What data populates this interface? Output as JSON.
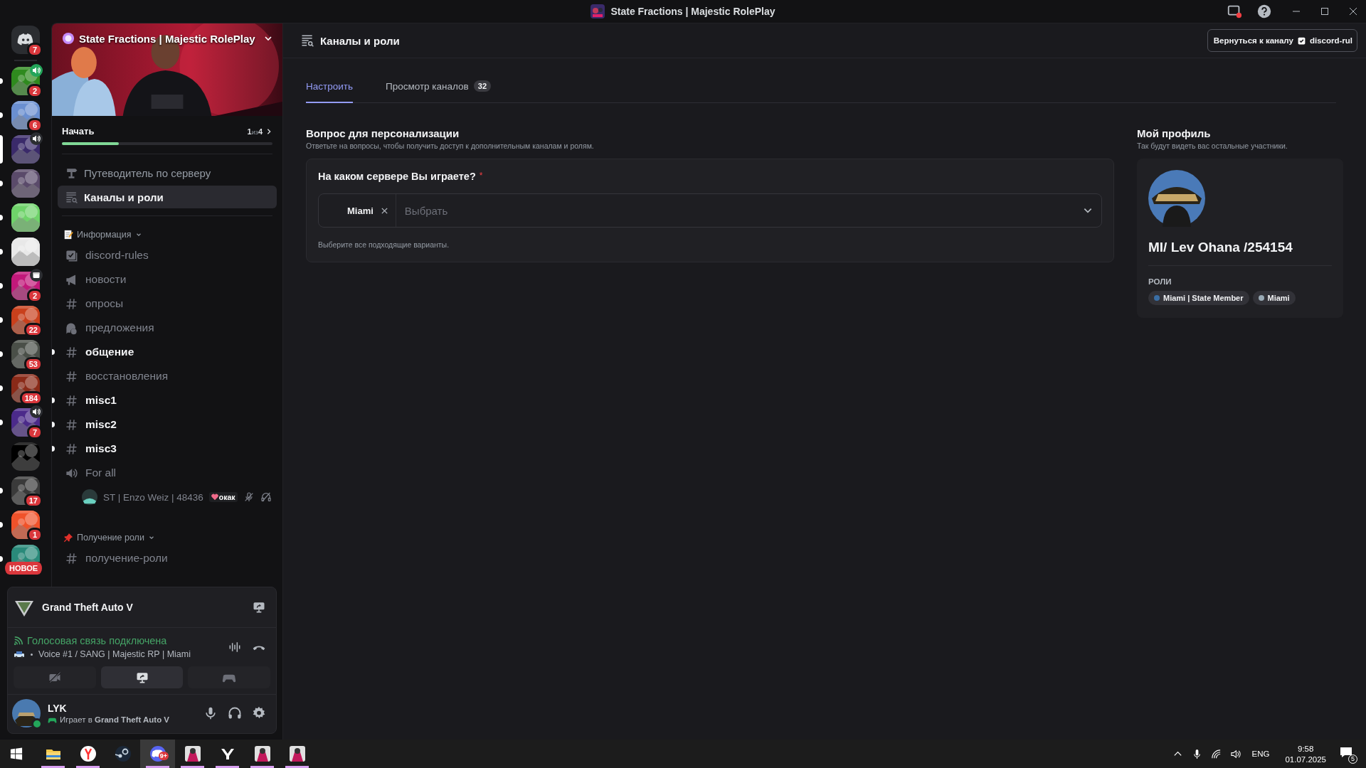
{
  "title_bar": {
    "title": "State Fractions | Majestic RolePlay"
  },
  "servers": [
    {
      "kind": "home",
      "badge": "7",
      "voice": false,
      "event": false,
      "unread": false,
      "selected": false,
      "color": "#2b2d31"
    },
    {
      "kind": "server",
      "badge": "2",
      "voice": true,
      "event": false,
      "unread": true,
      "selected": false,
      "color": "#2f8a1e"
    },
    {
      "kind": "server",
      "badge": "6",
      "voice": false,
      "event": false,
      "unread": true,
      "selected": false,
      "color": "#6a8fd0"
    },
    {
      "kind": "server",
      "voice": true,
      "event": false,
      "unread": false,
      "selected": true,
      "color": "#3a2a6a"
    },
    {
      "kind": "server",
      "voice": false,
      "event": false,
      "unread": true,
      "selected": false,
      "color": "#5a4a6a"
    },
    {
      "kind": "server",
      "voice": false,
      "event": false,
      "unread": true,
      "selected": false,
      "color": "#6fd36a"
    },
    {
      "kind": "server",
      "voice": false,
      "event": false,
      "unread": true,
      "selected": false,
      "color": "#e8e8e8"
    },
    {
      "kind": "server",
      "badge": "2",
      "voice": false,
      "event": true,
      "unread": true,
      "selected": false,
      "color": "#c2187a"
    },
    {
      "kind": "server",
      "badge": "22",
      "voice": false,
      "event": false,
      "unread": true,
      "selected": false,
      "color": "#c9401c"
    },
    {
      "kind": "server",
      "badge": "53",
      "voice": false,
      "event": false,
      "unread": true,
      "selected": false,
      "color": "#4a4f48"
    },
    {
      "kind": "server",
      "badge": "184",
      "voice": false,
      "event": false,
      "unread": true,
      "selected": false,
      "color": "#8a2a18"
    },
    {
      "kind": "server",
      "badge": "7",
      "voice": true,
      "event": false,
      "unread": true,
      "selected": false,
      "color": "#4b2a8a"
    },
    {
      "kind": "server",
      "voice": false,
      "event": false,
      "unread": false,
      "selected": false,
      "color": "#000000"
    },
    {
      "kind": "server",
      "badge": "17",
      "voice": false,
      "event": false,
      "unread": true,
      "selected": false,
      "color": "#3a3a3a"
    },
    {
      "kind": "server",
      "badge": "1",
      "voice": false,
      "event": false,
      "unread": true,
      "selected": false,
      "color": "#f0522a"
    },
    {
      "kind": "server",
      "new_label": "НОВОЕ",
      "voice": false,
      "event": false,
      "unread": true,
      "selected": false,
      "color": "#2a8a7a"
    }
  ],
  "server": {
    "name": "State Fractions | Majestic RolePlay"
  },
  "onboarding": {
    "label": "Начать",
    "step": "1",
    "of": "из",
    "total": "4",
    "level": 0.27
  },
  "nav": [
    {
      "kind": "guide",
      "label": "Путеводитель по серверу",
      "selected": false
    },
    {
      "kind": "browse",
      "label": "Каналы и роли",
      "selected": true
    }
  ],
  "categories": [
    {
      "name": "Информация",
      "channels": [
        {
          "kind": "rules",
          "name": "discord-rules",
          "unread": false
        },
        {
          "kind": "announce",
          "name": "новости",
          "unread": false
        },
        {
          "kind": "text",
          "name": "опросы",
          "unread": false
        },
        {
          "kind": "forum",
          "name": "предложения",
          "unread": false
        },
        {
          "kind": "text",
          "name": "общение",
          "unread": true
        },
        {
          "kind": "text",
          "name": "восстановления",
          "unread": false
        },
        {
          "kind": "text",
          "name": "misc1",
          "unread": true
        },
        {
          "kind": "text",
          "name": "misc2",
          "unread": true
        },
        {
          "kind": "text",
          "name": "misc3",
          "unread": true
        },
        {
          "kind": "voice",
          "name": "For all",
          "unread": false,
          "members": [
            {
              "name": "ST | Enzo Weiz | 48436",
              "tag": "окак"
            }
          ]
        }
      ]
    },
    {
      "name": "Получение роли",
      "channels": [
        {
          "kind": "text",
          "name": "получение-роли",
          "unread": false
        }
      ]
    }
  ],
  "voice_panel": {
    "activity": "Grand Theft Auto V",
    "status": "Голосовая связь подключена",
    "channel": "Voice #1 / SANG | Majestic RP | Miami",
    "buttons": [
      {
        "kind": "camera",
        "selected": false
      },
      {
        "kind": "screen",
        "selected": true
      },
      {
        "kind": "activity",
        "selected": false
      }
    ]
  },
  "user": {
    "name": "LYK",
    "activity": "Играет в **Grand Theft Auto V**"
  },
  "header": {
    "title": "Каналы и роли",
    "back_button": "Вернуться к каналу",
    "back_channel": "discord-rul"
  },
  "tabs": [
    {
      "label": "Настроить",
      "selected": true
    },
    {
      "label": "Просмотр каналов",
      "count": "32",
      "selected": false
    }
  ],
  "questions": {
    "title": "Вопрос для персонализации",
    "subtitle": "Ответьте на вопросы, чтобы получить доступ к дополнительным каналам и ролям.",
    "question": {
      "text": "На каком сервере Вы играете?",
      "required_mark": "*",
      "chips": [
        "Miami"
      ],
      "placeholder": "Выбрать",
      "hint": "Выберите все подходящие варианты."
    }
  },
  "profile": {
    "title": "Мой профиль",
    "subtitle": "Так будут видеть вас остальные участники.",
    "name": "MI/ Lev Ohana /254154",
    "roles_label": "РОЛИ",
    "roles": [
      {
        "name": "Miami | State Member",
        "color": "#3a6ea5"
      },
      {
        "name": "Miami",
        "color": "#99aab5"
      }
    ]
  },
  "taskbar": {
    "apps": [
      {
        "kind": "explorer",
        "open": true,
        "selected": false
      },
      {
        "kind": "yandex",
        "open": true,
        "selected": false
      },
      {
        "kind": "steam",
        "open": false,
        "selected": false
      },
      {
        "kind": "discord",
        "open": true,
        "selected": true,
        "badge": "9+"
      },
      {
        "kind": "game",
        "open": true,
        "selected": false
      },
      {
        "kind": "y",
        "open": true,
        "selected": false
      },
      {
        "kind": "game",
        "open": true,
        "selected": false
      },
      {
        "kind": "game",
        "open": true,
        "selected": false
      }
    ],
    "language": "ENG",
    "time": "9:58",
    "date": "01.07.2025",
    "notifications": "5"
  }
}
